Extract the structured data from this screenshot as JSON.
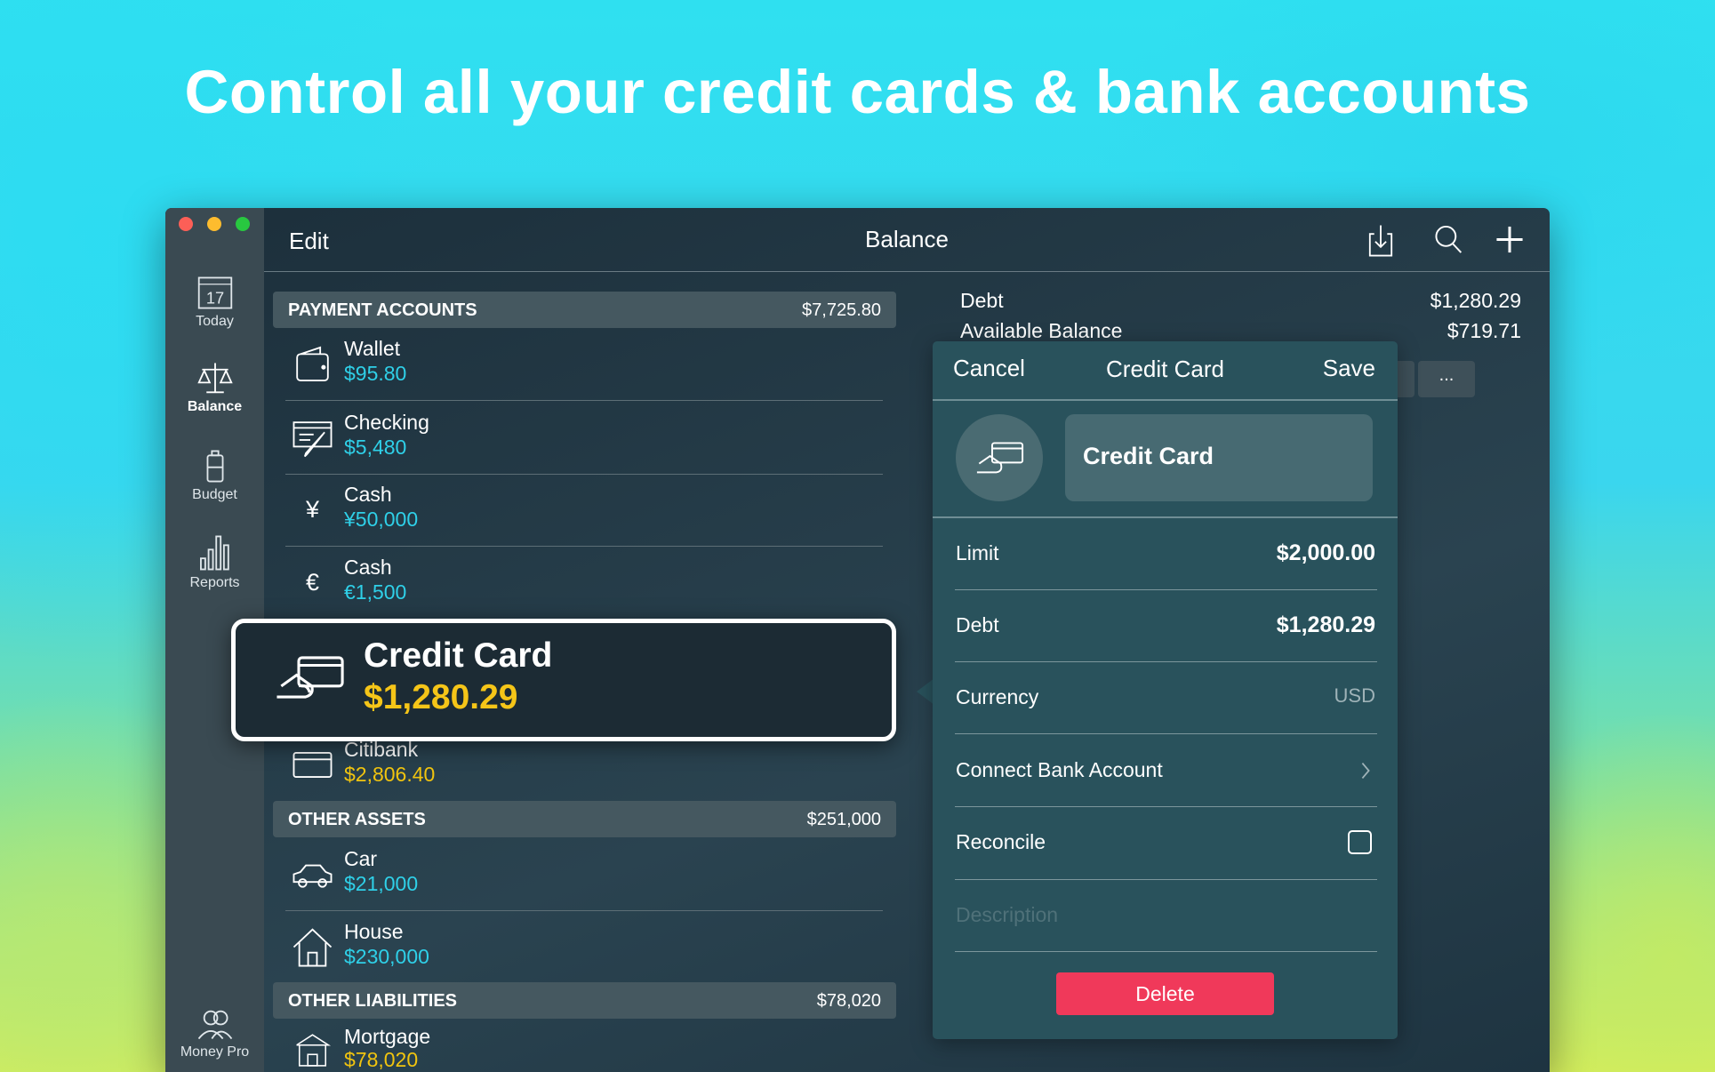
{
  "headline": "Control all your credit cards & bank accounts",
  "colors": {
    "accent_amount": "#2fd0e8",
    "highlight_amount": "#f1c40f",
    "delete": "#f0395a",
    "panel": "#29525c"
  },
  "sidebar": {
    "items": [
      {
        "label": "Today",
        "icon": "calendar-icon",
        "day": "17"
      },
      {
        "label": "Balance",
        "icon": "scales-icon"
      },
      {
        "label": "Budget",
        "icon": "budget-icon"
      },
      {
        "label": "Reports",
        "icon": "chart-icon"
      },
      {
        "label": "Money Pro",
        "icon": "users-icon"
      }
    ]
  },
  "toolbar": {
    "edit": "Edit",
    "title": "Balance",
    "icons": [
      "import-icon",
      "search-icon",
      "plus-icon"
    ]
  },
  "sections": [
    {
      "title": "PAYMENT ACCOUNTS",
      "total": "$7,725.80",
      "accounts": [
        {
          "name": "Wallet",
          "amount": "$95.80",
          "icon": "wallet-icon"
        },
        {
          "name": "Checking",
          "amount": "$5,480",
          "icon": "check-icon"
        },
        {
          "name": "Cash",
          "amount": "¥50,000",
          "icon": "yen-icon",
          "glyph": "¥"
        },
        {
          "name": "Cash",
          "amount": "€1,500",
          "icon": "euro-icon",
          "glyph": "€"
        },
        {
          "name": "Citibank",
          "amount": "$2,806.40",
          "icon": "card-icon"
        }
      ]
    },
    {
      "title": "OTHER ASSETS",
      "total": "$251,000",
      "accounts": [
        {
          "name": "Car",
          "amount": "$21,000",
          "icon": "car-icon"
        },
        {
          "name": "House",
          "amount": "$230,000",
          "icon": "house-icon"
        }
      ]
    },
    {
      "title": "OTHER LIABILITIES",
      "total": "$78,020",
      "accounts": [
        {
          "name": "Mortgage",
          "amount": "$78,020",
          "icon": "mortgage-icon"
        }
      ]
    }
  ],
  "highlight": {
    "name": "Credit Card",
    "amount": "$1,280.29"
  },
  "summary": {
    "debt_label": "Debt",
    "debt": "$1,280.29",
    "available_label": "Available Balance",
    "available": "$719.71",
    "more": "..."
  },
  "editor": {
    "cancel": "Cancel",
    "title": "Credit Card",
    "save": "Save",
    "name_value": "Credit Card",
    "rows": [
      {
        "label": "Limit",
        "value": "$2,000.00"
      },
      {
        "label": "Debt",
        "value": "$1,280.29"
      },
      {
        "label": "Currency",
        "value": "USD"
      },
      {
        "label": "Connect Bank Account"
      },
      {
        "label": "Reconcile",
        "checked": false
      }
    ],
    "description_placeholder": "Description",
    "delete": "Delete"
  }
}
